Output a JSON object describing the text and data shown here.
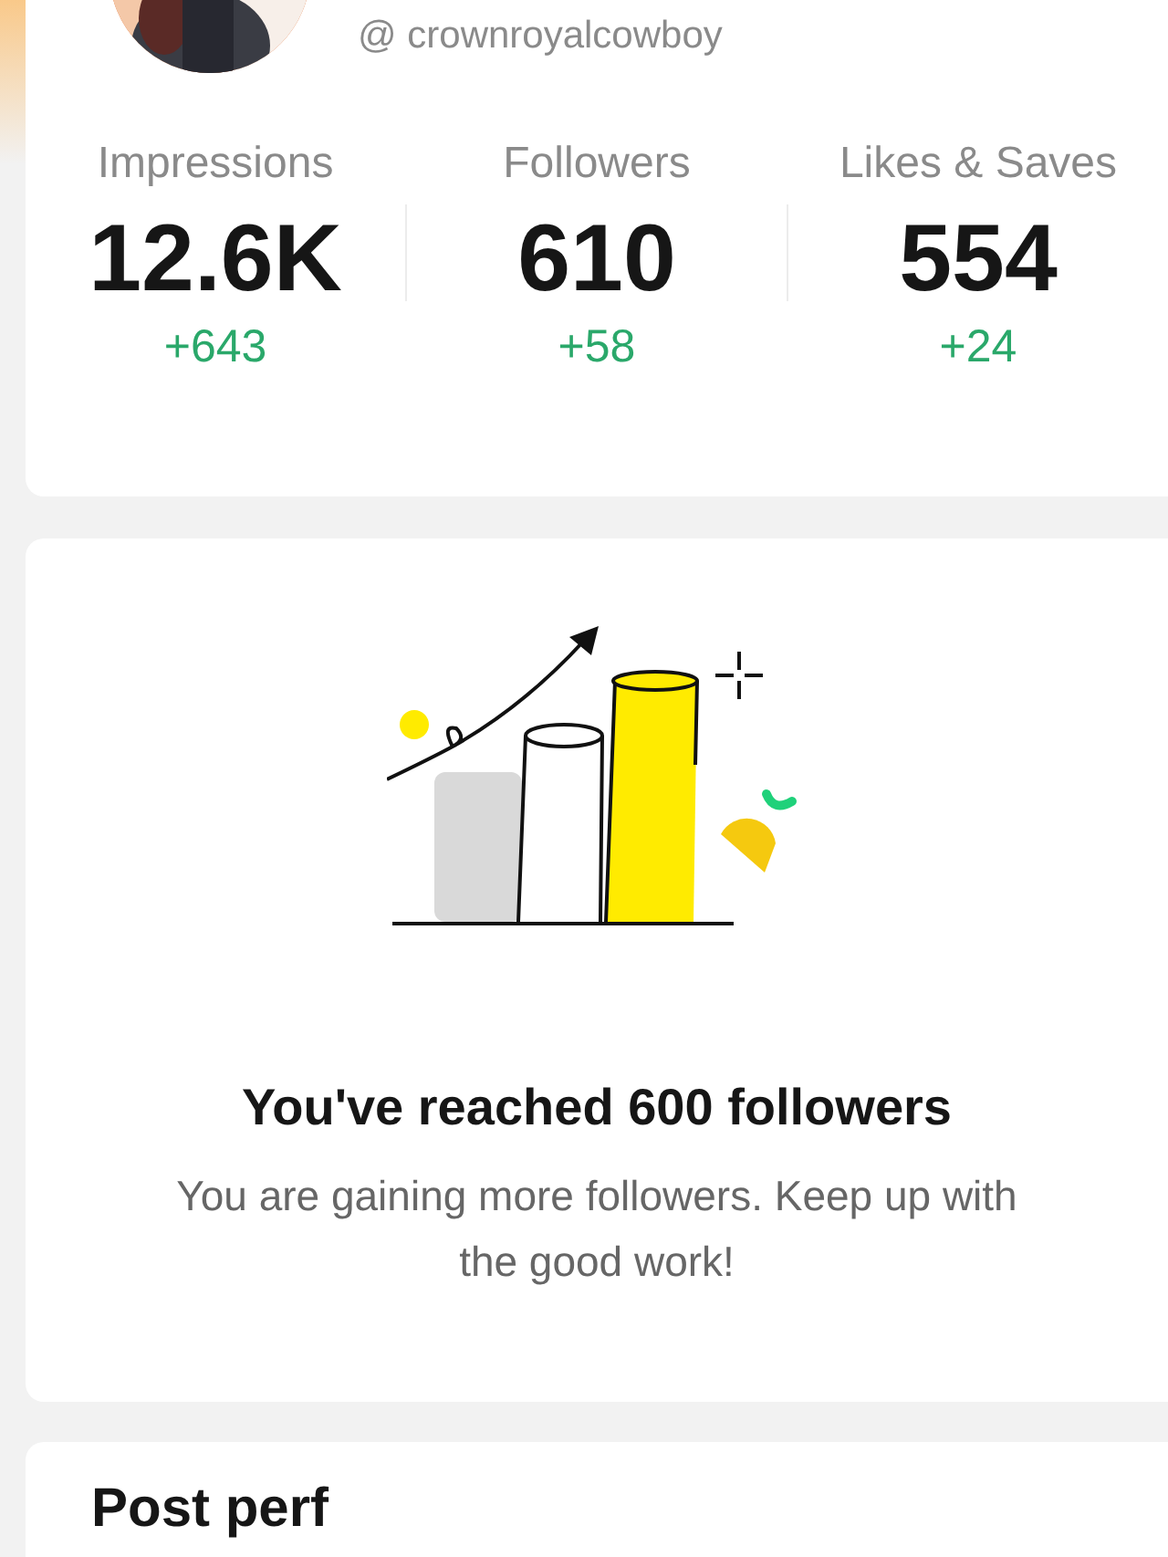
{
  "profile": {
    "handle": "@ crownroyalcowboy"
  },
  "stats": [
    {
      "label": "Impressions",
      "value": "12.6K",
      "change": "+643"
    },
    {
      "label": "Followers",
      "value": "610",
      "change": "+58"
    },
    {
      "label": "Likes & Saves",
      "value": "554",
      "change": "+24"
    }
  ],
  "milestone": {
    "title": "You've reached 600 followers",
    "message": "You are gaining more followers. Keep up with the good work!"
  },
  "next_section": {
    "title": "Post perf"
  }
}
